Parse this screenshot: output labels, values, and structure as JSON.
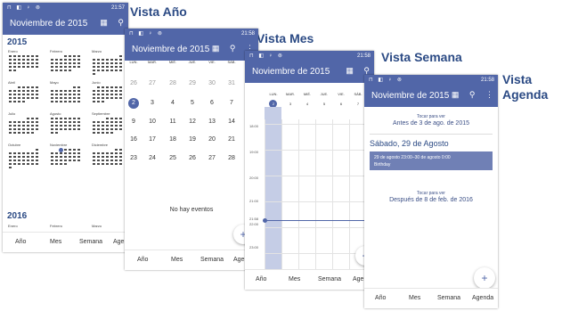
{
  "status": {
    "left_icons": "⊓ ◧ ♀ ⊚",
    "time": "21:58",
    "time_year": "21:57"
  },
  "labels": {
    "year": "Vista Año",
    "month": "Vista Mes",
    "week": "Vista Semana",
    "agenda_1": "Vista",
    "agenda_2": "Agenda"
  },
  "header": {
    "title": "Noviembre de 2015",
    "calendar_icon": "▦",
    "search_icon": "⚲",
    "more_icon": "⋮"
  },
  "year_view": {
    "year_title": "2015",
    "months": [
      "Enero",
      "Febrero",
      "Marzo",
      "Abril",
      "Mayo",
      "Junio",
      "Julio",
      "Agosto",
      "Septiembre",
      "Octubre",
      "Noviembre",
      "Diciembre"
    ],
    "next_year": "2016",
    "next_months": [
      "Enero",
      "Febrero",
      "Marzo"
    ]
  },
  "month_view": {
    "weekdays": [
      "LUN.",
      "MAR.",
      "MIÉ.",
      "JUE.",
      "VIE.",
      "SÁB."
    ],
    "rows": [
      [
        "26",
        "27",
        "28",
        "29",
        "30",
        "31"
      ],
      [
        "2",
        "3",
        "4",
        "5",
        "6",
        "7"
      ],
      [
        "9",
        "10",
        "11",
        "12",
        "13",
        "14"
      ],
      [
        "16",
        "17",
        "18",
        "19",
        "20",
        "21"
      ],
      [
        "23",
        "24",
        "25",
        "26",
        "27",
        "28"
      ]
    ],
    "no_events": "No hay eventos"
  },
  "week_view": {
    "weekdays": [
      "LUN.",
      "MAR.",
      "MIÉ.",
      "JUE.",
      "VIE.",
      "SÁB."
    ],
    "dates": [
      "2",
      "3",
      "4",
      "5",
      "6",
      "7"
    ],
    "hours": [
      "18:00",
      "19:00",
      "20:00",
      "21:00",
      "21:58",
      "22:00",
      "23:00"
    ]
  },
  "agenda_view": {
    "tap_hint": "Tocar para ver",
    "before": "Antes de 3 de ago. de 2015",
    "date_header": "Sábado, 29 de Agosto",
    "event_time": "29 de agosto 23:00–30 de agosto 0:00",
    "event_title": "Birthday",
    "after": "Después de 8 de feb. de 2016"
  },
  "bottom_nav": {
    "year": "Año",
    "month": "Mes",
    "week": "Semana",
    "agenda": "Agenda",
    "agenda_cut": "Agen"
  },
  "fab": {
    "plus": "+"
  },
  "colors": {
    "primary": "#5166a8",
    "label": "#2b4a84",
    "event": "#7080b5"
  }
}
